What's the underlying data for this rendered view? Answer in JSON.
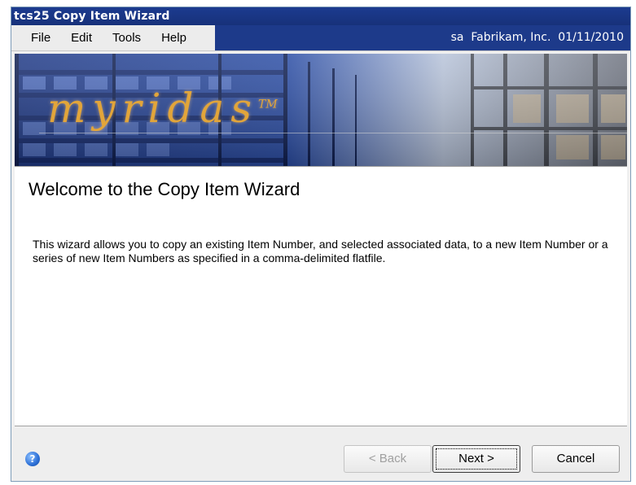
{
  "window": {
    "title": "tcs25 Copy Item Wizard"
  },
  "menu": {
    "items": [
      {
        "label": "File"
      },
      {
        "label": "Edit"
      },
      {
        "label": "Tools"
      },
      {
        "label": "Help"
      }
    ],
    "user_info": "sa  Fabrikam, Inc.  01/11/2010"
  },
  "banner": {
    "logo_text": "myridas",
    "trademark": "TM",
    "logo_color": "#e2a53a"
  },
  "content": {
    "title": "Welcome to the Copy Item Wizard",
    "description": "This wizard allows you to copy an existing Item Number, and selected associated data, to a new Item Number or a series of new Item Numbers as specified in a comma-delimited flatfile."
  },
  "footer": {
    "help_icon": "help-icon",
    "help_glyph": "?",
    "back_label": "< Back",
    "next_label": "Next >",
    "cancel_label": "Cancel"
  },
  "colors": {
    "title_bar": "#1c3b8f",
    "user_info_bg": "#1d3a8a"
  }
}
